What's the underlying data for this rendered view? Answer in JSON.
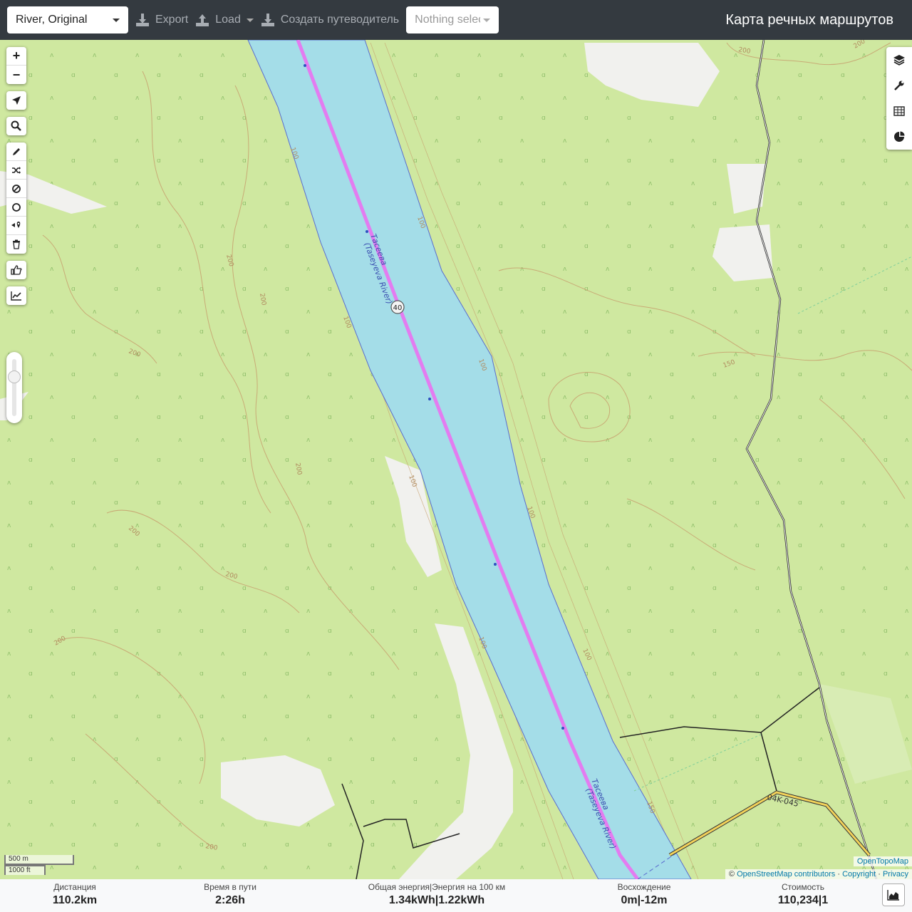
{
  "topbar": {
    "profile": "River, Original",
    "export_label": "Export",
    "load_label": "Load",
    "guide_label": "Создать путеводитель",
    "selection_placeholder": "Nothing selected",
    "app_title": "Карта речных маршрутов"
  },
  "map": {
    "river_name_ru": "Тасеева",
    "river_name_en": "(Taseyeva River)",
    "route_marker": "40",
    "road_ref": "04K-045",
    "contour_labels": [
      "200",
      "100",
      "150"
    ],
    "colors": {
      "land": "#cfe8a0",
      "water": "#a4dde8",
      "route": "#e37cf0",
      "bare": "#f1f1ee"
    }
  },
  "left_controls": {
    "zoom_in": "+",
    "zoom_out": "−",
    "icons": [
      "locate-icon",
      "search-icon",
      "draw-icon",
      "shuffle-icon",
      "no-entry-icon",
      "circle-icon",
      "poi-icon",
      "trash-icon",
      "thumbs-up-icon",
      "elevation-chart-icon"
    ]
  },
  "right_controls": {
    "icons": [
      "layers-icon",
      "wrench-icon",
      "table-icon",
      "pie-chart-icon"
    ]
  },
  "scale": {
    "metric": "500 m",
    "imperial": "1000 ft"
  },
  "attribution": {
    "copyright": "©",
    "osm": "OpenStreetMap contributors",
    "sep1": "·",
    "copy": "Copyright",
    "sep2": "·",
    "privacy": "Privacy",
    "tiles": "OpenTopoMap"
  },
  "stats": {
    "distance_label": "Дистанция",
    "distance_value": "110.2",
    "distance_unit": "km",
    "time_label": "Время в пути",
    "time_value": "2:26",
    "time_unit": "h",
    "energy_label": "Общая энергия|Энергия на 100 км",
    "energy_value1": "1.34",
    "energy_unit1": "kWh",
    "energy_sep": "|",
    "energy_value2": "1.22",
    "energy_unit2": "kWh",
    "ascent_label": "Восхождение",
    "ascent_value1": "0",
    "ascent_unit1": "m",
    "ascent_sep": "|",
    "ascent_value2": "-12",
    "ascent_unit2": "m",
    "cost_label": "Стоимость",
    "cost_value": "110,234",
    "cost_sep": "|",
    "cost_value2": "1"
  }
}
